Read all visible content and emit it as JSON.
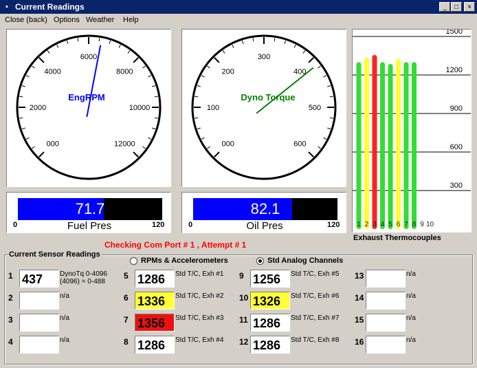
{
  "window": {
    "title": "Current Readings",
    "min": "_",
    "max": "□",
    "close": "×"
  },
  "menu": [
    "Close (back)",
    "Options",
    "Weather",
    "Help"
  ],
  "gauges": {
    "rpm": {
      "label": "EngRPM",
      "ticks": [
        "000",
        "2000",
        "4000",
        "6000",
        "8000",
        "10000",
        "12000"
      ],
      "needle_fraction": 0.54,
      "color": "#0000ff"
    },
    "torque": {
      "label": "Dyno Torque",
      "ticks": [
        "000",
        "100",
        "200",
        "300",
        "400",
        "500",
        "600"
      ],
      "needle_fraction": 0.69,
      "color": "#008000"
    }
  },
  "bars": {
    "fuel": {
      "value": "71.7",
      "level": 0.597,
      "min": "0",
      "max": "120",
      "label": "Fuel Pres"
    },
    "oil": {
      "value": "82.1",
      "level": 0.684,
      "min": "0",
      "max": "120",
      "label": "Oil Pres"
    }
  },
  "thermo": {
    "title": "Exhaust Thermocouples",
    "scale": [
      "1500",
      "1200",
      "900",
      "600",
      "300"
    ],
    "max": 1500,
    "numbers": [
      "1",
      "2",
      "3",
      "4",
      "5",
      "6",
      "7",
      "8",
      "9",
      "10"
    ],
    "values": [
      1300,
      1336,
      1356,
      1300,
      1286,
      1326,
      1300,
      1300,
      0,
      0
    ],
    "colors": [
      "#33dd33",
      "#ffff33",
      "#ff2222",
      "#33dd33",
      "#33dd33",
      "#ffff33",
      "#33dd33",
      "#33dd33",
      "#33dd33",
      "#33dd33"
    ]
  },
  "status": "Checking Com Port # 1 , Attempt # 1",
  "sensors": {
    "title": "Current Sensor Readings",
    "mode_rpm": "RPMs & Accelerometers",
    "mode_analog": "Std Analog Channels",
    "channels": [
      {
        "num": "1",
        "value": "437",
        "desc": "DynoTq 0-4096",
        "desc2": "(4096) = 0-488",
        "bg": "#ffffff"
      },
      {
        "num": "2",
        "value": "",
        "desc": "n/a",
        "desc2": "",
        "bg": "#ffffff"
      },
      {
        "num": "3",
        "value": "",
        "desc": "n/a",
        "desc2": "",
        "bg": "#ffffff"
      },
      {
        "num": "4",
        "value": "",
        "desc": "n/a",
        "desc2": "",
        "bg": "#ffffff"
      },
      {
        "num": "5",
        "value": "1286",
        "desc": "Std T/C, Exh #1",
        "desc2": "",
        "bg": "#ffffff"
      },
      {
        "num": "6",
        "value": "1336",
        "desc": "Std T/C, Exh #2",
        "desc2": "",
        "bg": "#ffff33"
      },
      {
        "num": "7",
        "value": "1356",
        "desc": "Std T/C, Exh #3",
        "desc2": "",
        "bg": "#ee1111"
      },
      {
        "num": "8",
        "value": "1286",
        "desc": "Std T/C, Exh #4",
        "desc2": "",
        "bg": "#ffffff"
      },
      {
        "num": "9",
        "value": "1256",
        "desc": "Std T/C, Exh #5",
        "desc2": "",
        "bg": "#ffffff"
      },
      {
        "num": "10",
        "value": "1326",
        "desc": "Std T/C, Exh #6",
        "desc2": "",
        "bg": "#ffff33"
      },
      {
        "num": "11",
        "value": "1286",
        "desc": "Std T/C, Exh #7",
        "desc2": "",
        "bg": "#ffffff"
      },
      {
        "num": "12",
        "value": "1286",
        "desc": "Std T/C, Exh #8",
        "desc2": "",
        "bg": "#ffffff"
      },
      {
        "num": "13",
        "value": "",
        "desc": "n/a",
        "desc2": "",
        "bg": "#ffffff"
      },
      {
        "num": "14",
        "value": "",
        "desc": "n/a",
        "desc2": "",
        "bg": "#ffffff"
      },
      {
        "num": "15",
        "value": "",
        "desc": "n/a",
        "desc2": "",
        "bg": "#ffffff"
      },
      {
        "num": "16",
        "value": "",
        "desc": "n/a",
        "desc2": "",
        "bg": "#ffffff"
      }
    ]
  }
}
